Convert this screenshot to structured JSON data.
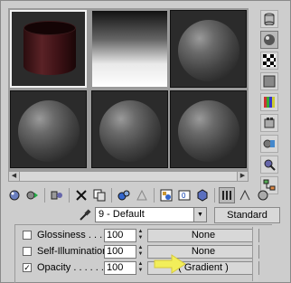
{
  "material_name": "9 - Default",
  "material_type": "Standard",
  "slots": [
    {
      "kind": "cylinder"
    },
    {
      "kind": "gradient"
    },
    {
      "kind": "sphere"
    },
    {
      "kind": "sphere"
    },
    {
      "kind": "sphere"
    },
    {
      "kind": "sphere"
    }
  ],
  "properties": [
    {
      "label": "Glossiness . . . .",
      "value": "100",
      "checked": false,
      "check_mark": "",
      "map": "None"
    },
    {
      "label": "Self-Illumination .",
      "value": "100",
      "checked": false,
      "check_mark": "",
      "map": "None"
    },
    {
      "label": "Opacity . . . . . . .",
      "value": "100",
      "checked": true,
      "check_mark": "✓",
      "map": "( Gradient )"
    }
  ],
  "accent_color_arrow": "#f2ee5a"
}
